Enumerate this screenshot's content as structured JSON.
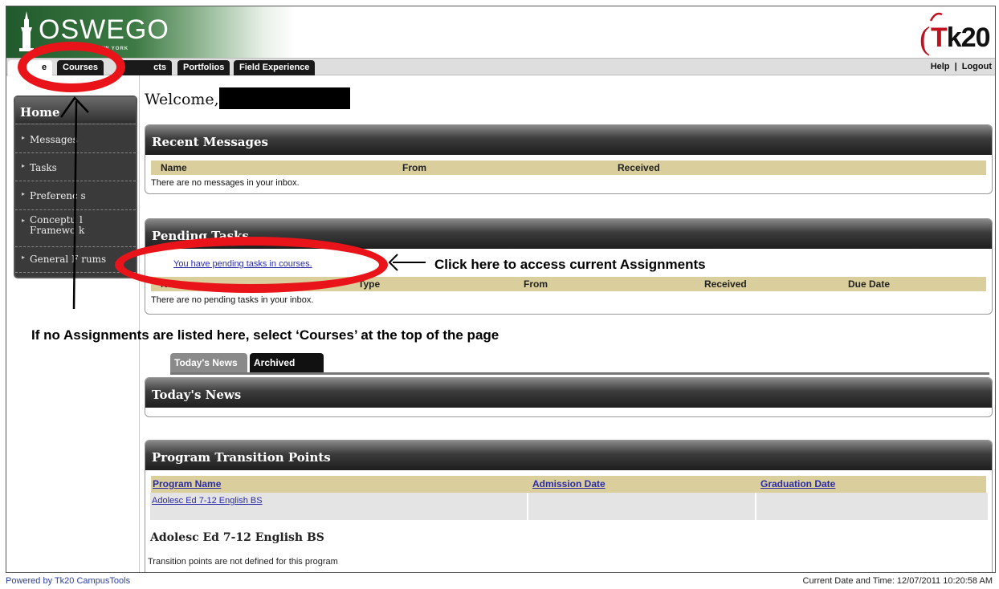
{
  "header": {
    "logo_text": "OSWEGO",
    "logo_sub": "E UNIVERSITY OF NEW YORK",
    "brand_right": "Tk20"
  },
  "nav": {
    "tabs": [
      {
        "label": "Home",
        "visible": "e",
        "active": true
      },
      {
        "label": "Courses"
      },
      {
        "label": "Projects",
        "visible": "cts"
      },
      {
        "label": "Portfolios"
      },
      {
        "label": "Field Experience"
      }
    ],
    "right": {
      "help": "Help",
      "separator": "|",
      "logout": "Logout"
    }
  },
  "sidebar": {
    "title": "Home",
    "items": [
      "Messages",
      "Tasks",
      "Preferences",
      "Conceptual Framework",
      "General Forums"
    ],
    "items_display": [
      "Messages",
      "Tasks",
      "Preferenc s",
      "Conceptu l\nFramewo k",
      "General F rums"
    ]
  },
  "welcome": {
    "text": "Welcome,"
  },
  "recent_messages": {
    "title": "Recent Messages",
    "columns": [
      "Name",
      "From",
      "Received"
    ],
    "empty_text": "There are no messages in your inbox."
  },
  "pending_tasks": {
    "title": "Pending Tasks",
    "title_display": "Pending Tasks",
    "link_text": "You have pending tasks in courses.",
    "columns": [
      "Na",
      "Type",
      "From",
      "Received",
      "Due Date"
    ],
    "empty_text": "There are no pending tasks in your inbox."
  },
  "news": {
    "tabs": [
      "Today's News",
      "Archived News"
    ],
    "title": "Today's News"
  },
  "transition_points": {
    "title": "Program Transition Points",
    "columns": [
      "Program Name",
      "Admission Date",
      "Graduation Date"
    ],
    "rows": [
      [
        "Adolesc Ed 7-12 English BS",
        "",
        ""
      ]
    ],
    "program_heading": "Adolesc Ed 7-12 English BS",
    "note": "Transition points are not defined for this program"
  },
  "annotations": {
    "click_here": "Click here to access current Assignments",
    "if_none": "If no Assignments are listed here, select ‘Courses’ at the top of the page",
    "color": "#e8141a"
  },
  "footer": {
    "powered": "Powered by Tk20 CampusTools",
    "datetime": "Current Date and Time: 12/07/2011 10:20:58 AM"
  }
}
